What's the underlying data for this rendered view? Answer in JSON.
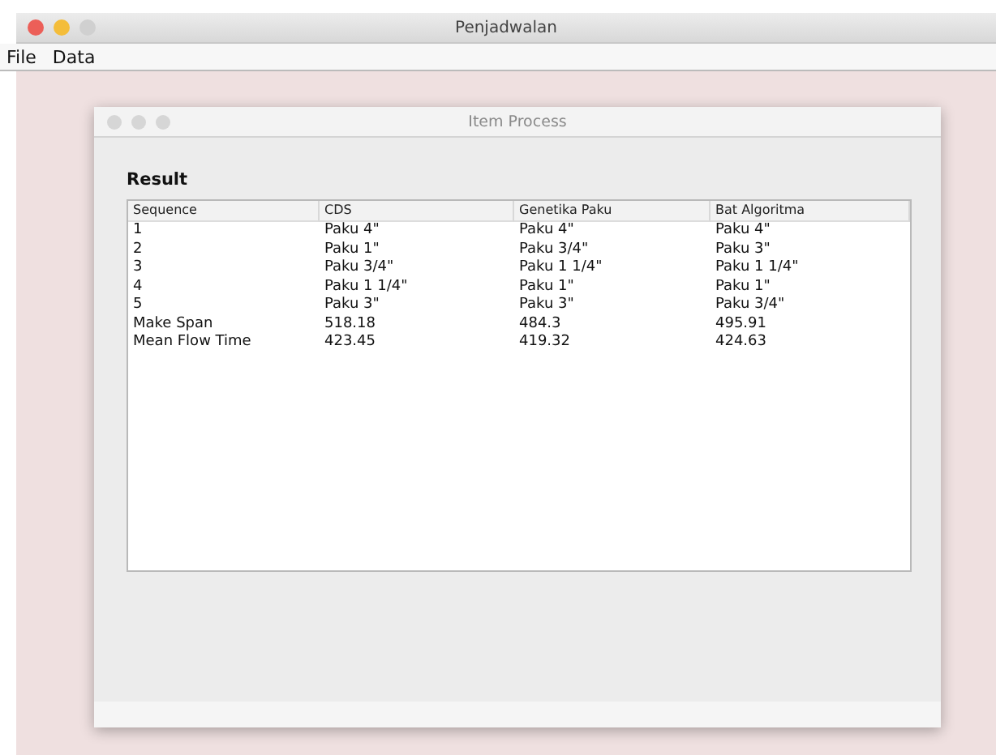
{
  "window": {
    "title": "Penjadwalan"
  },
  "menu": [
    "File",
    "Data"
  ],
  "dialog": {
    "title": "Item Process",
    "heading": "Result",
    "table": {
      "columns": [
        "Sequence",
        "CDS",
        "Genetika Paku",
        "Bat Algoritma"
      ],
      "rows": [
        [
          "1",
          "Paku 4\"",
          "Paku 4\"",
          "Paku 4\""
        ],
        [
          "2",
          "Paku 1\"",
          "Paku 3/4\"",
          "Paku 3\""
        ],
        [
          "3",
          "Paku 3/4\"",
          "Paku 1 1/4\"",
          "Paku 1 1/4\""
        ],
        [
          "4",
          "Paku 1 1/4\"",
          "Paku 1\"",
          "Paku 1\""
        ],
        [
          "5",
          "Paku 3\"",
          "Paku 3\"",
          "Paku 3/4\""
        ],
        [
          "Make Span",
          "518.18",
          "484.3",
          "495.91"
        ],
        [
          "Mean Flow Time",
          "423.45",
          "419.32",
          "424.63"
        ]
      ]
    }
  }
}
